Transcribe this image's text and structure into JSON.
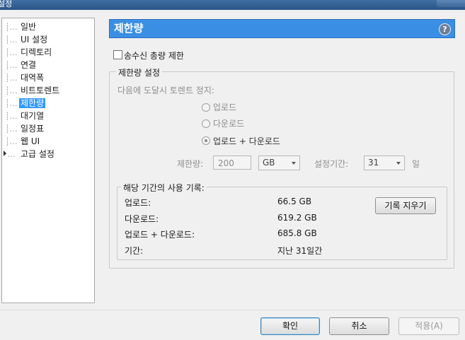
{
  "window": {
    "title": "설정"
  },
  "sidebar": {
    "items": [
      {
        "label": "일반"
      },
      {
        "label": "UI 설정"
      },
      {
        "label": "디렉토리"
      },
      {
        "label": "연결"
      },
      {
        "label": "대역폭"
      },
      {
        "label": "비트토렌트"
      },
      {
        "label": "제한량",
        "selected": true
      },
      {
        "label": "대기열"
      },
      {
        "label": "일정표"
      },
      {
        "label": "웹 UI"
      },
      {
        "label": "고급 설정",
        "expandable": true
      }
    ]
  },
  "header": {
    "title": "제한량",
    "help_icon": "question-icon"
  },
  "transfer_limit_checkbox": {
    "label": "송수신 총량 제한",
    "checked": false
  },
  "limit_settings": {
    "legend": "제한량 설정",
    "stop_label": "다음에 도달시 토렌트 정지:",
    "radios": [
      {
        "label": "업로드",
        "checked": false
      },
      {
        "label": "다운로드",
        "checked": false
      },
      {
        "label": "업로드 + 다운로드",
        "checked": true
      }
    ],
    "limit_label": "제한량:",
    "limit_value": "200",
    "unit_value": "GB",
    "period_label": "설정기간:",
    "period_value": "31",
    "period_unit": "일"
  },
  "usage": {
    "legend": "해당 기간의 사용 기록:",
    "rows": [
      {
        "label": "업로드:",
        "value": "66.5 GB"
      },
      {
        "label": "다운로드:",
        "value": "619.2 GB"
      },
      {
        "label": "업로드 + 다운로드:",
        "value": "685.8 GB"
      },
      {
        "label": "기간:",
        "value": "지난 31일간"
      }
    ],
    "clear_button": "기록 지우기"
  },
  "footer": {
    "ok": "확인",
    "cancel": "취소",
    "apply": "적용(A)"
  }
}
